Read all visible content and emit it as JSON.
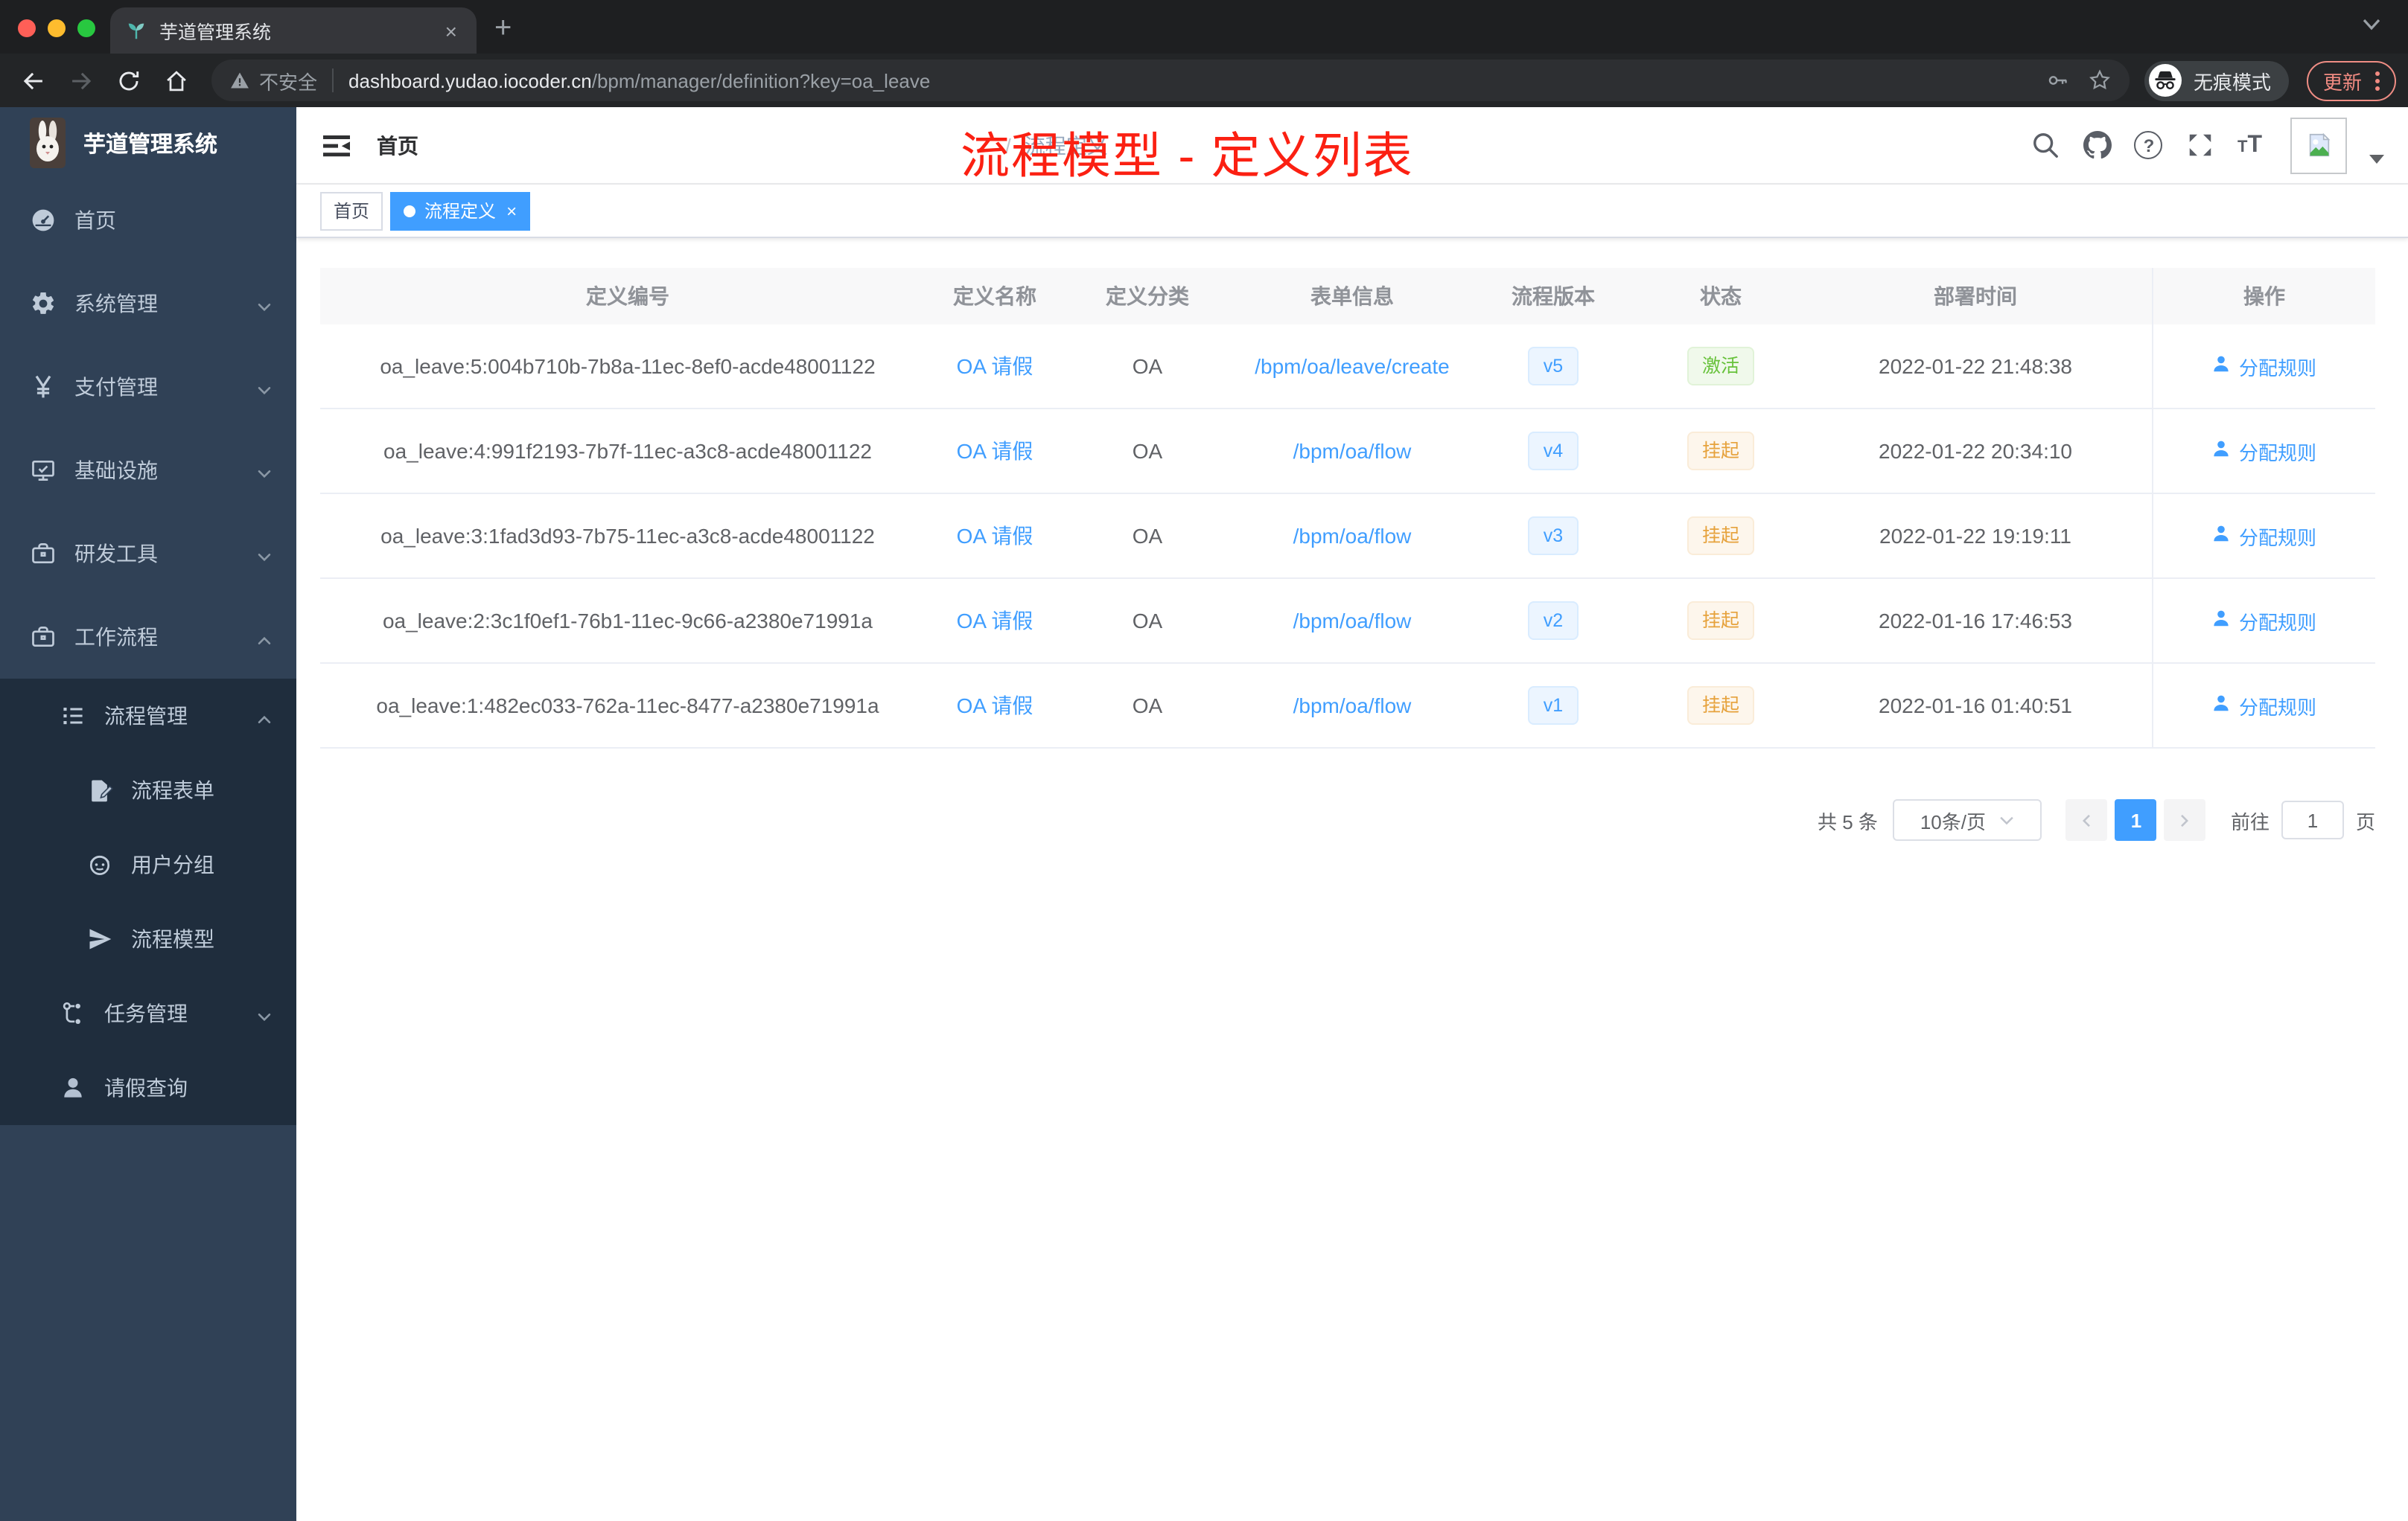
{
  "browser": {
    "tab_title": "芋道管理系统",
    "new_tab_label": "+",
    "close_tab_label": "×",
    "security_label": "不安全",
    "url_host": "dashboard.yudao.iocoder.cn",
    "url_path": "/bpm/manager/definition?key=oa_leave",
    "incognito_label": "无痕模式",
    "update_label": "更新"
  },
  "sidebar": {
    "app_title": "芋道管理系统",
    "items": [
      {
        "label": "首页",
        "slug": "home",
        "icon": "dashboard-icon",
        "level": 1,
        "expand": null,
        "dark": false
      },
      {
        "label": "系统管理",
        "slug": "system-management",
        "icon": "gear-icon",
        "level": 1,
        "expand": "down",
        "dark": false
      },
      {
        "label": "支付管理",
        "slug": "payment-management",
        "icon": "yen-icon",
        "level": 1,
        "expand": "down",
        "dark": false
      },
      {
        "label": "基础设施",
        "slug": "infrastructure",
        "icon": "monitor-icon",
        "level": 1,
        "expand": "down",
        "dark": false
      },
      {
        "label": "研发工具",
        "slug": "dev-tools",
        "icon": "toolbox-icon",
        "level": 1,
        "expand": "down",
        "dark": false
      },
      {
        "label": "工作流程",
        "slug": "workflow",
        "icon": "briefcase-icon",
        "level": 1,
        "expand": "up",
        "dark": false
      },
      {
        "label": "流程管理",
        "slug": "process-management",
        "icon": "list-icon",
        "level": 2,
        "expand": "up",
        "dark": true
      },
      {
        "label": "流程表单",
        "slug": "process-form",
        "icon": "form-icon",
        "level": 3,
        "expand": null,
        "dark": true
      },
      {
        "label": "用户分组",
        "slug": "user-group",
        "icon": "robot-icon",
        "level": 3,
        "expand": null,
        "dark": true
      },
      {
        "label": "流程模型",
        "slug": "process-model",
        "icon": "paper-plane-icon",
        "level": 3,
        "expand": null,
        "dark": true
      },
      {
        "label": "任务管理",
        "slug": "task-management",
        "icon": "flow-icon",
        "level": 2,
        "expand": "down",
        "dark": true
      },
      {
        "label": "请假查询",
        "slug": "leave-query",
        "icon": "user-icon",
        "level": 2,
        "expand": null,
        "dark": true
      }
    ]
  },
  "navbar": {
    "breadcrumb": [
      "首页",
      "流程定义"
    ],
    "breadcrumb_separator": "/"
  },
  "annotation": {
    "text": "流程模型 - 定义列表",
    "color": "#fb2012"
  },
  "tags": [
    {
      "label": "首页",
      "active": false
    },
    {
      "label": "流程定义",
      "active": true,
      "close_label": "×"
    }
  ],
  "table": {
    "columns": [
      "定义编号",
      "定义名称",
      "定义分类",
      "表单信息",
      "流程版本",
      "状态",
      "部署时间",
      "操作"
    ],
    "rows": [
      {
        "id": "oa_leave:5:004b710b-7b8a-11ec-8ef0-acde48001122",
        "name": "OA 请假",
        "category": "OA",
        "form": "/bpm/oa/leave/create",
        "version": "v5",
        "status": "激活",
        "status_type": "active",
        "time": "2022-01-22 21:48:38",
        "action": "分配规则"
      },
      {
        "id": "oa_leave:4:991f2193-7b7f-11ec-a3c8-acde48001122",
        "name": "OA 请假",
        "category": "OA",
        "form": "/bpm/oa/flow",
        "version": "v4",
        "status": "挂起",
        "status_type": "suspended",
        "time": "2022-01-22 20:34:10",
        "action": "分配规则"
      },
      {
        "id": "oa_leave:3:1fad3d93-7b75-11ec-a3c8-acde48001122",
        "name": "OA 请假",
        "category": "OA",
        "form": "/bpm/oa/flow",
        "version": "v3",
        "status": "挂起",
        "status_type": "suspended",
        "time": "2022-01-22 19:19:11",
        "action": "分配规则"
      },
      {
        "id": "oa_leave:2:3c1f0ef1-76b1-11ec-9c66-a2380e71991a",
        "name": "OA 请假",
        "category": "OA",
        "form": "/bpm/oa/flow",
        "version": "v2",
        "status": "挂起",
        "status_type": "suspended",
        "time": "2022-01-16 17:46:53",
        "action": "分配规则"
      },
      {
        "id": "oa_leave:1:482ec033-762a-11ec-8477-a2380e71991a",
        "name": "OA 请假",
        "category": "OA",
        "form": "/bpm/oa/flow",
        "version": "v1",
        "status": "挂起",
        "status_type": "suspended",
        "time": "2022-01-16 01:40:51",
        "action": "分配规则"
      }
    ]
  },
  "pagination": {
    "total_label": "共 5 条",
    "page_size": "10条/页",
    "current_page": "1",
    "goto_label": "前往",
    "goto_value": "1",
    "page_unit": "页"
  },
  "colors": {
    "accent": "#409eff",
    "success": "#67c23a",
    "warning": "#e6a23c",
    "sidebar_bg": "#304156",
    "sidebar_submenu_bg": "#1f2d3d",
    "annotation_red": "#fb2012"
  }
}
